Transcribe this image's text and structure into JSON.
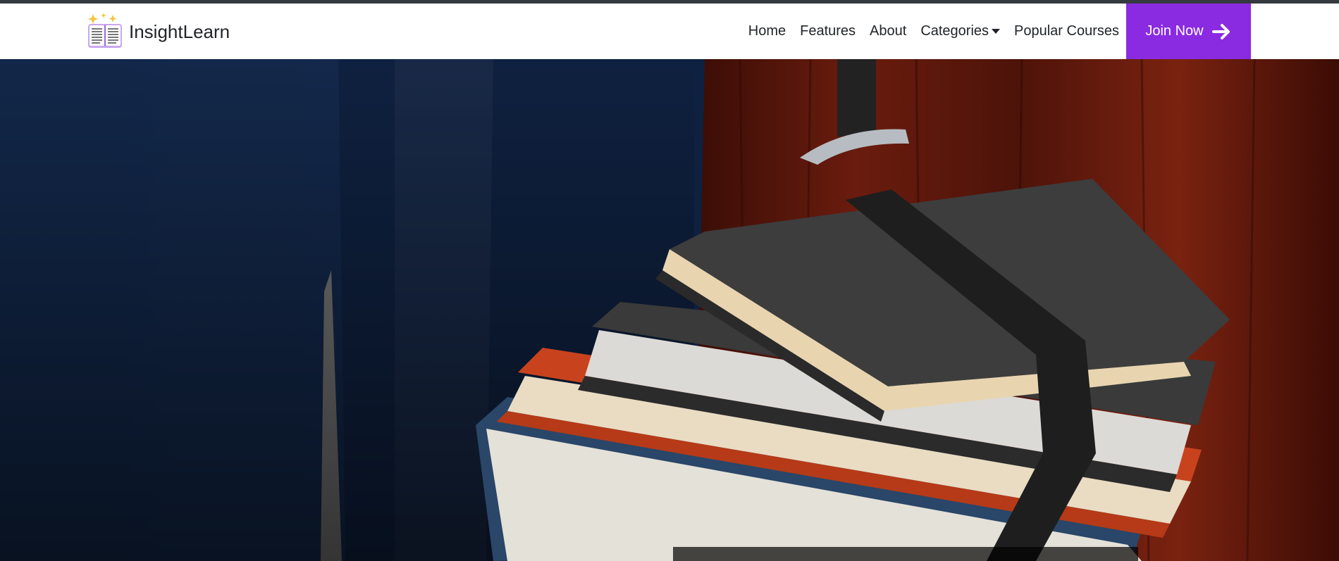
{
  "brand": {
    "name": "InsightLearn",
    "logo_icon": "open-book-sparkle-icon"
  },
  "nav": {
    "items": [
      {
        "label": "Home"
      },
      {
        "label": "Features"
      },
      {
        "label": "About"
      },
      {
        "label": "Categories",
        "has_dropdown": true
      },
      {
        "label": "Popular Courses"
      }
    ],
    "cta": {
      "label": "Join Now",
      "icon": "arrow-right-icon"
    }
  },
  "colors": {
    "accent": "#8a2be2",
    "top_strip": "#343a40",
    "nav_bg": "#ffffff",
    "text": "#212529"
  },
  "hero": {
    "image": "stack-of-books-with-strap-photo"
  }
}
